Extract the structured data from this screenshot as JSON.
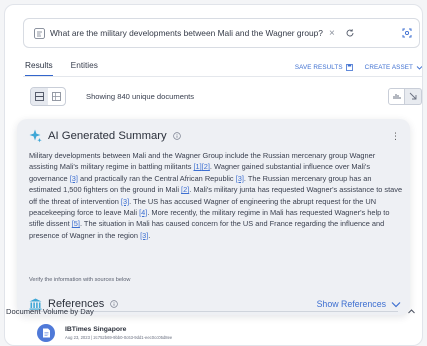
{
  "search": {
    "query": "What are the military developments between Mali and the Wagner group?",
    "clear_glyph": "×"
  },
  "tabs": [
    {
      "label": "Results",
      "active": true
    },
    {
      "label": "Entities",
      "active": false
    }
  ],
  "actions": {
    "save_results": "SAVE RESULTS",
    "create_asset": "CREATE ASSET"
  },
  "toolbar": {
    "document_count": "Showing 840 unique documents"
  },
  "summary": {
    "title": "AI Generated Summary",
    "menu_glyph": "⋮",
    "segments": [
      {
        "text": "Military developments between Mali and the Wagner Group include the Russian mercenary group Wagner assisting Mali's military regime in battling militants "
      },
      {
        "cite": "[1]"
      },
      {
        "cite": "[2]"
      },
      {
        "text": ". Wagner gained substantial influence over Mali's governance "
      },
      {
        "cite": "[3]"
      },
      {
        "text": " and practically ran the Central African Republic "
      },
      {
        "cite": "[3]"
      },
      {
        "text": ". The Russian mercenary group has an estimated 1,500 fighters on the ground in Mali "
      },
      {
        "cite": "[2]"
      },
      {
        "text": ". Mali's military junta has requested Wagner's assistance to stave off the threat of intervention "
      },
      {
        "cite": "[3]"
      },
      {
        "text": ". The US has accused Wagner of engineering the abrupt request for the UN peacekeeping force to leave Mali "
      },
      {
        "cite": "[4]"
      },
      {
        "text": ". More recently, the military regime in Mali has requested Wagner's help to stifle dissent "
      },
      {
        "cite": "[5]"
      },
      {
        "text": ". The situation in Mali has caused concern for the US and France regarding the influence and presence of Wagner in the region "
      },
      {
        "cite": "[3]"
      },
      {
        "text": "."
      }
    ],
    "verify_note": "Verify the information with sources below"
  },
  "references": {
    "title": "References",
    "show_label": "Show References"
  },
  "volume": {
    "title": "Document Volume by Day"
  },
  "document": {
    "source": "IBTimes Singapore",
    "subline": "Aug 23, 2023 | 2c752b69-9bb0-0c63-9dd1-eec0cc05d8ee"
  },
  "colors": {
    "accent": "#3d6fd1",
    "summary_bg": "#eef0f4",
    "sparkle": "#3fa7d6"
  }
}
